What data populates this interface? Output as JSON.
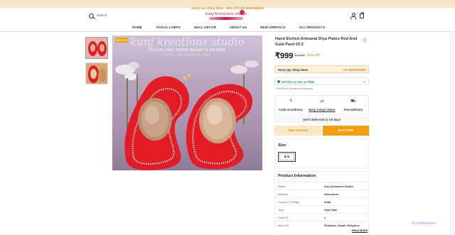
{
  "announcement": "Hurry Up, Shop Now! - 50% Off     +91-9540386385",
  "header": {
    "search_placeholder": "Search",
    "logo_text": "kunj kreations studio"
  },
  "nav": [
    "HOME",
    "POOJA LAMPS",
    "WALL DECOR",
    "ABOUT US",
    "NEW ARRIVALS",
    "ALL PRODUCTS"
  ],
  "gallery": {
    "sale_badge": "50% Off",
    "image_brand": "kunj kreations studio",
    "image_tagline": "FULFILLING YOUR HEART'S DESIRE",
    "image_countries": "INDIA · AUSTRALIA · USA"
  },
  "product": {
    "title": "Hand Etched Artisanal Diya Plates Red And Gold Pack Of 2",
    "price": "₹999",
    "mrp": "₹2,099",
    "discount": "52% Off"
  },
  "hurry": {
    "text": "Hurry Up, Shop Now!",
    "phone": "+91-9540386385"
  },
  "offer": {
    "text": "Get this as low as ₹850",
    "tax_note": "Final Price (inclusive of all taxes)"
  },
  "services": [
    {
      "icon": "₹",
      "label": "Cash on Delivery"
    },
    {
      "icon": "⇄",
      "label": "Easy 5 days return"
    },
    {
      "icon": "⛟",
      "label": "Free Delivery"
    }
  ],
  "delivery_note": "Get it delivered in 4-9 days",
  "buttons": {
    "add_to_bag": "ADD TO BAG",
    "buy_now": "BUY NOW"
  },
  "size": {
    "heading": "Size",
    "selected": "5 in"
  },
  "product_info": {
    "heading": "Product Information",
    "rows": [
      {
        "key": "Brand",
        "value": "Kunj Kreations Studio"
      },
      {
        "key": "Material",
        "value": "Aluminium"
      },
      {
        "key": "Country Of Origin",
        "value": "India"
      },
      {
        "key": "Type",
        "value": "Diya Plate"
      },
      {
        "key": "Pack Of",
        "value": "2"
      },
      {
        "key": "Ideal For",
        "value": "Festivals, Diwali, Religious"
      }
    ],
    "read_more": "READ MORE"
  },
  "watermark": "ScanMalware",
  "colors": {
    "accent": "#f59e0b",
    "accent_light": "#fde8c4",
    "offer_green": "#2e9e44",
    "plate_red": "#e21b24"
  }
}
